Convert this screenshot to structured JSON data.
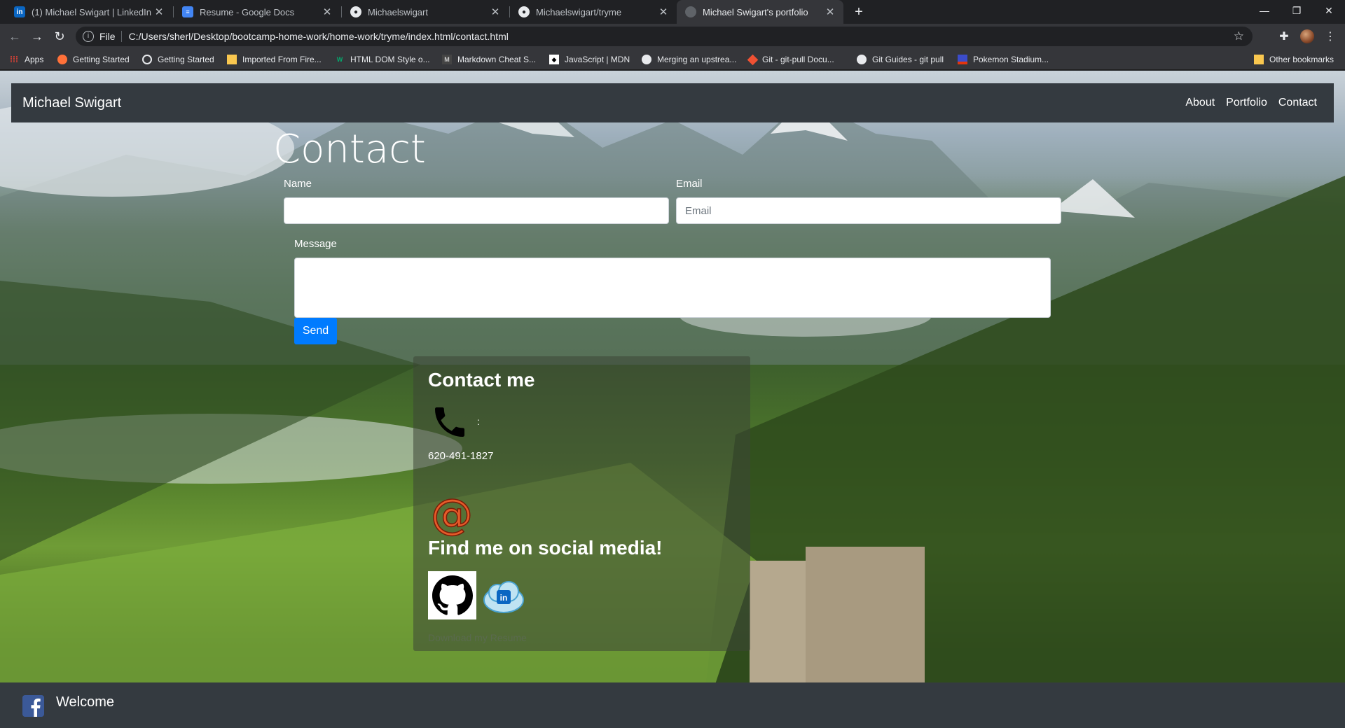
{
  "browser": {
    "tabs": [
      {
        "title": "(1) Michael Swigart | LinkedIn",
        "icon": "linkedin-icon"
      },
      {
        "title": "Resume - Google Docs",
        "icon": "google-docs-icon"
      },
      {
        "title": "Michaelswigart",
        "icon": "github-icon"
      },
      {
        "title": "Michaelswigart/tryme",
        "icon": "github-icon"
      },
      {
        "title": "Michael Swigart's portfolio",
        "icon": "globe-icon"
      }
    ],
    "address": {
      "scheme": "File",
      "url": "C:/Users/sherl/Desktop/bootcamp-home-work/home-work/tryme/index.html/contact.html"
    },
    "bookmarks": [
      {
        "label": "Apps",
        "icon": "apps-grid-icon"
      },
      {
        "label": "Getting Started",
        "icon": "firefox-icon"
      },
      {
        "label": "Getting Started",
        "icon": "globe-icon"
      },
      {
        "label": "Imported From Fire...",
        "icon": "folder-icon"
      },
      {
        "label": "HTML DOM Style o...",
        "icon": "w3schools-icon"
      },
      {
        "label": "Markdown Cheat S...",
        "icon": "markdown-icon"
      },
      {
        "label": "JavaScript | MDN",
        "icon": "mdn-icon"
      },
      {
        "label": "Merging an upstrea...",
        "icon": "github-icon"
      },
      {
        "label": "Git - git-pull Docu...",
        "icon": "git-icon"
      },
      {
        "label": "Git Guides - git pull",
        "icon": "github-icon"
      },
      {
        "label": "Pokemon Stadium...",
        "icon": "pokemon-icon"
      }
    ],
    "other_bookmarks": "Other bookmarks"
  },
  "site": {
    "brand": "Michael Swigart",
    "nav": [
      "About",
      "Portfolio",
      "Contact"
    ],
    "page_title": "Contact",
    "form": {
      "name_label": "Name",
      "name_value": "",
      "email_label": "Email",
      "email_placeholder": "Email",
      "message_label": "Message",
      "message_value": "",
      "send_label": "Send"
    },
    "card": {
      "heading": "Contact me",
      "phone_colon": ":",
      "phone": "620-491-1827",
      "social_heading": "Find me on social media!",
      "resume_link": "Download my Resume"
    },
    "footer": {
      "welcome": "Welcome"
    }
  }
}
